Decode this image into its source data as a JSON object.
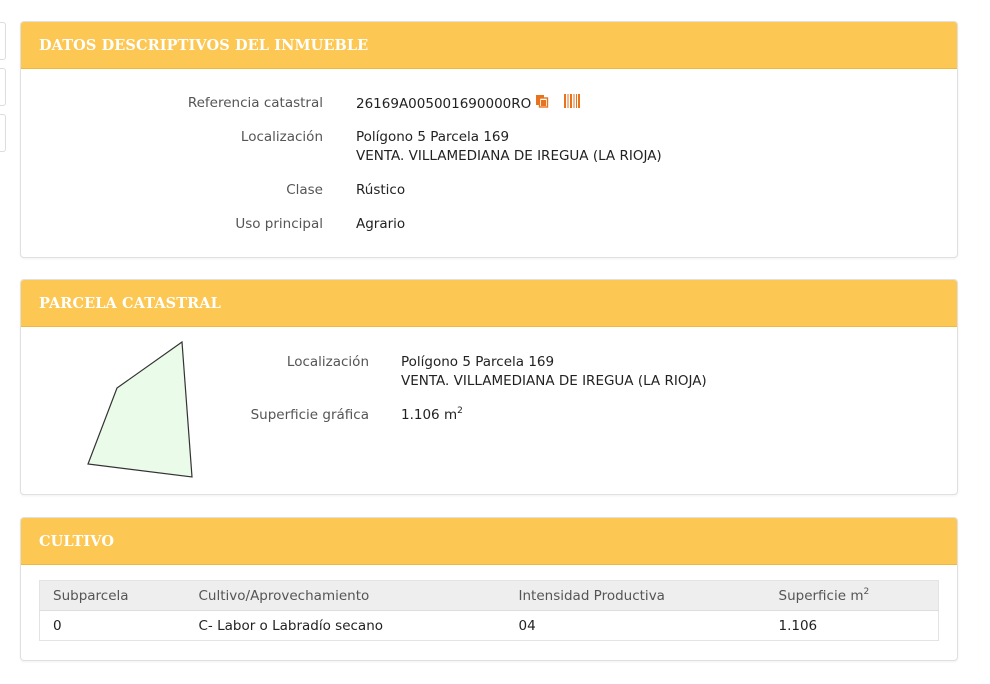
{
  "descriptivos": {
    "title": "DATOS DESCRIPTIVOS DEL INMUEBLE",
    "referencia_label": "Referencia catastral",
    "referencia_value": "26169A005001690000RO",
    "localizacion_label": "Localización",
    "localizacion_line1": "Polígono 5 Parcela 169",
    "localizacion_line2": "VENTA. VILLAMEDIANA DE IREGUA (LA RIOJA)",
    "clase_label": "Clase",
    "clase_value": "Rústico",
    "uso_label": "Uso principal",
    "uso_value": "Agrario",
    "icons": [
      "copy-icon",
      "barcode-icon"
    ]
  },
  "parcela": {
    "title": "PARCELA CATASTRAL",
    "localizacion_label": "Localización",
    "localizacion_line1": "Polígono 5 Parcela 169",
    "localizacion_line2": "VENTA. VILLAMEDIANA DE IREGUA (LA RIOJA)",
    "superficie_label": "Superficie gráfica",
    "superficie_value": "1.106 m",
    "superficie_unit_sup": "2"
  },
  "cultivo": {
    "title": "CULTIVO",
    "headers": [
      "Subparcela",
      "Cultivo/Aprovechamiento",
      "Intensidad Productiva",
      "Superficie m"
    ],
    "header_sup": "2",
    "rows": [
      [
        "0",
        "C- Labor o Labradío secano",
        "04",
        "1.106"
      ]
    ]
  },
  "colors": {
    "header_bg": "#fdc754",
    "header_text": "#ffffff",
    "icon_orange": "#e8731e",
    "parcel_fill": "#ebfbe9",
    "parcel_stroke": "#333333"
  }
}
